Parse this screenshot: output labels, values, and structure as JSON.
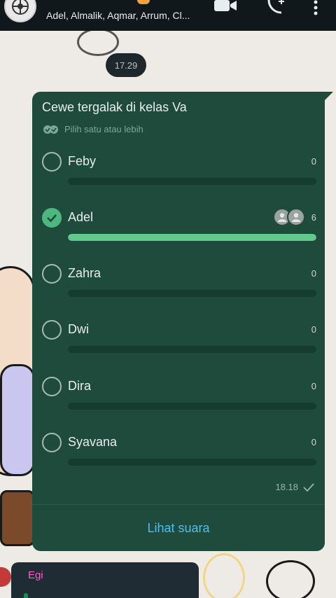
{
  "header": {
    "members": "Adel, Almalik, Aqmar, Arrum, Cl...",
    "icons": [
      "group-avatar-icon",
      "video-call-icon",
      "add-call-icon",
      "more-vert-icon"
    ]
  },
  "chat": {
    "time_chip": "17.29"
  },
  "poll": {
    "question": "Cewe tergalak di kelas Va",
    "hint": "Pilih satu atau lebih",
    "options": [
      {
        "label": "Feby",
        "count": "0",
        "fraction": 0,
        "checked": false
      },
      {
        "label": "Adel",
        "count": "6",
        "fraction": 1,
        "checked": true
      },
      {
        "label": "Zahra",
        "count": "0",
        "fraction": 0,
        "checked": false
      },
      {
        "label": "Dwi",
        "count": "0",
        "fraction": 0,
        "checked": false
      },
      {
        "label": "Dira",
        "count": "0",
        "fraction": 0,
        "checked": false
      },
      {
        "label": "Syavana",
        "count": "0",
        "fraction": 0,
        "checked": false
      }
    ],
    "time": "18.18",
    "view_votes": "Lihat suara"
  },
  "next_message": {
    "sender": "Egi"
  },
  "colors": {
    "bubble": "#1e4b3b",
    "accent_green": "#4cb87f",
    "link_blue": "#53bdeb",
    "sender_pink": "#ff5bd0"
  }
}
